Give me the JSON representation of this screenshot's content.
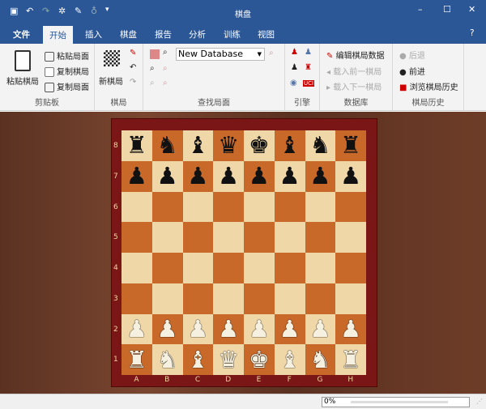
{
  "window": {
    "title": "棋盘"
  },
  "tabs": [
    "文件",
    "开始",
    "插入",
    "棋盘",
    "报告",
    "分析",
    "训练",
    "视图"
  ],
  "ribbon": {
    "clipboard": {
      "label": "剪贴板",
      "paste_game": "粘贴棋局",
      "paste_position": "粘贴局面",
      "copy_game": "复制棋局",
      "copy_position": "复制局面"
    },
    "game": {
      "label": "棋局",
      "new_game": "新棋局"
    },
    "find": {
      "label": "查找局面",
      "database": "New Database"
    },
    "engine": {
      "label": "引擎",
      "uci": "UCI"
    },
    "database": {
      "label": "数据库",
      "edit": "编辑棋局数据",
      "load_prev": "载入前一棋局",
      "load_next": "载入下一棋局"
    },
    "history": {
      "label": "棋局历史",
      "back": "后退",
      "forward": "前进",
      "browse": "浏览棋局历史"
    }
  },
  "board": {
    "ranks": [
      "8",
      "7",
      "6",
      "5",
      "4",
      "3",
      "2",
      "1"
    ],
    "files": [
      "A",
      "B",
      "C",
      "D",
      "E",
      "F",
      "G",
      "H"
    ],
    "position": [
      "rnbqkbnr",
      "pppppppp",
      "8",
      "8",
      "8",
      "8",
      "PPPPPPPP",
      "RNBQKBNR"
    ]
  },
  "status": {
    "progress": "0%"
  },
  "colors": {
    "accent": "#2b5797",
    "light_square": "#efd7a8",
    "dark_square": "#c8692a"
  }
}
